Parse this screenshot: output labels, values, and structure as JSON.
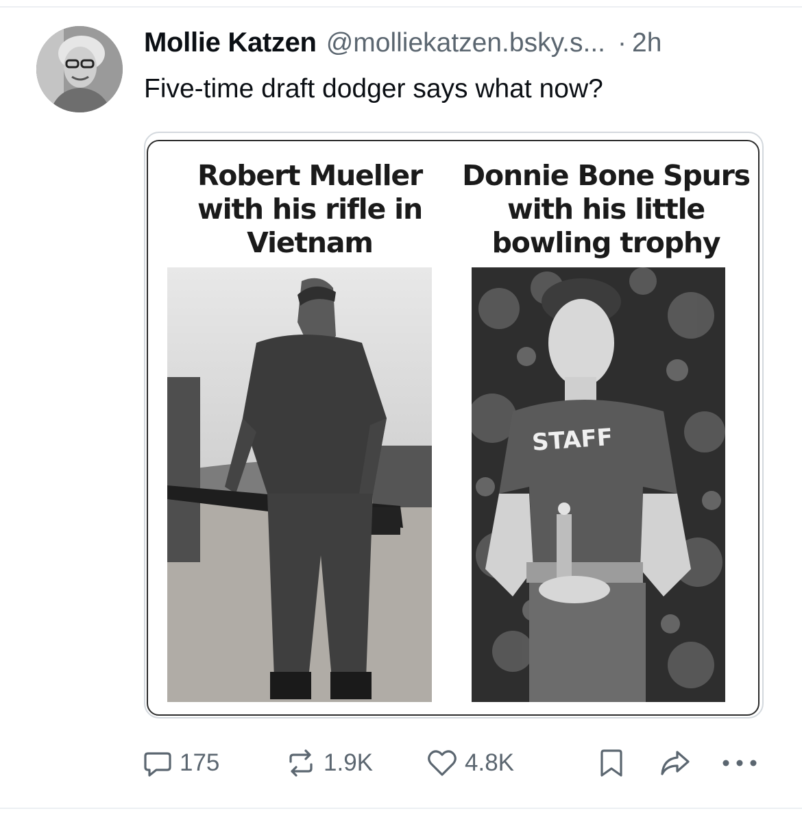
{
  "post": {
    "author": {
      "display_name": "Mollie Katzen",
      "handle": "@molliekatzen.bsky.s...",
      "avatar_icon": "profile-photo"
    },
    "separator": "·",
    "timestamp": "2h",
    "text": "Five-time draft dodger says what now?"
  },
  "embed": {
    "left_caption": "Robert Mueller with his rifle in Vietnam",
    "right_caption": "Donnie Bone Spurs with his little bowling trophy",
    "right_shirt_text": "STAFF",
    "left_photo": "black-and-white photo of a soldier holding a rifle",
    "right_photo": "black-and-white photo of a young man holding a small trophy"
  },
  "actions": {
    "reply_count": "175",
    "repost_count": "1.9K",
    "like_count": "4.8K",
    "icons": [
      "reply-icon",
      "repost-icon",
      "like-icon",
      "bookmark-icon",
      "share-icon",
      "more-icon"
    ]
  },
  "colors": {
    "text_primary": "#0b0f14",
    "text_secondary": "#5b6670",
    "border": "#d3d8dd"
  }
}
